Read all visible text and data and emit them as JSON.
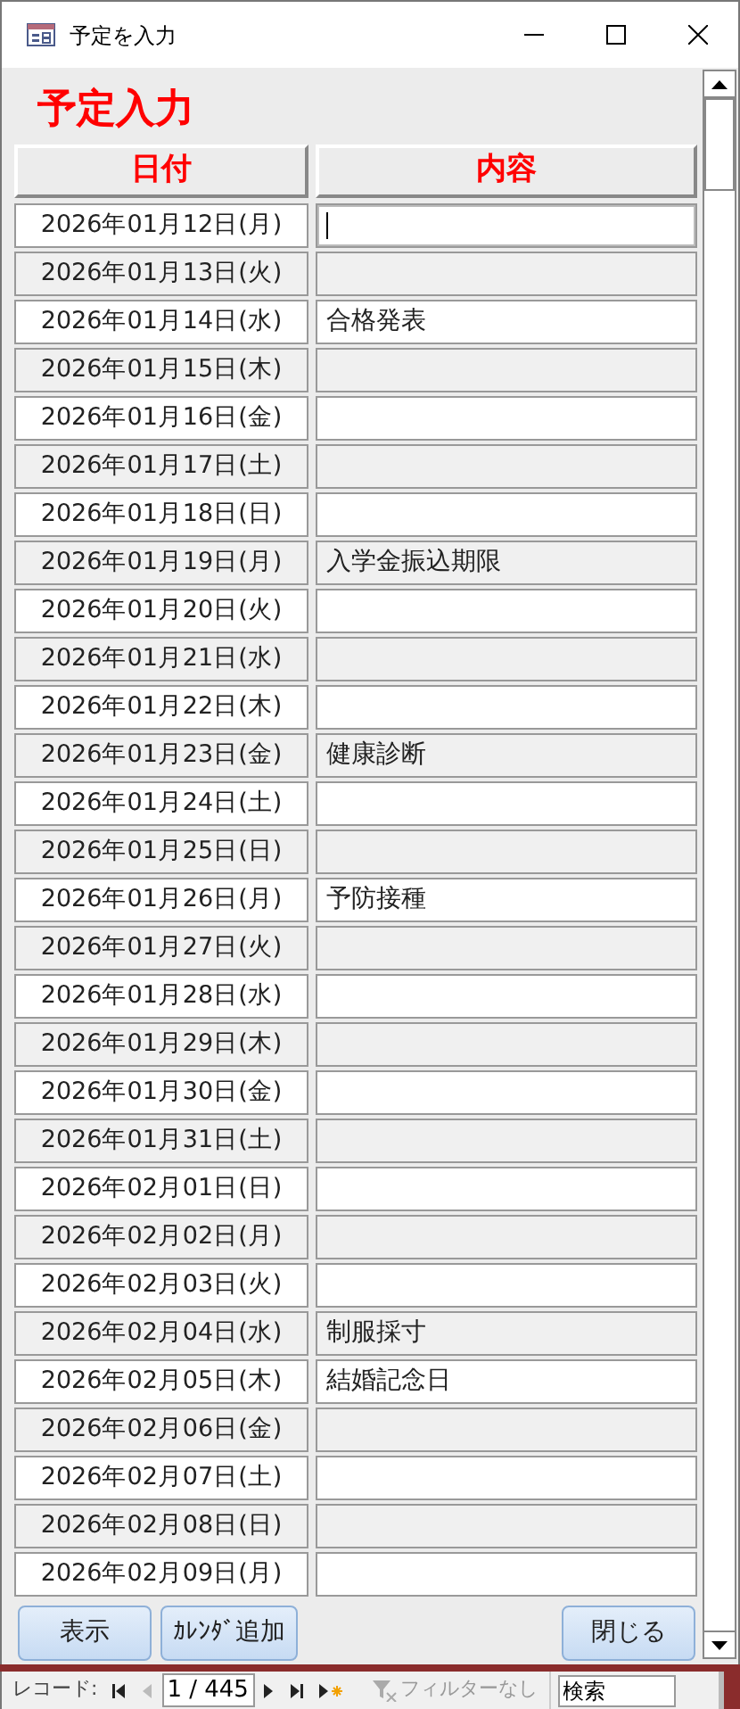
{
  "window": {
    "title": "予定を入力"
  },
  "form": {
    "heading": "予定入力",
    "columns": [
      "日付",
      "内容"
    ],
    "rows": [
      {
        "date": "2026年01月12日(月)",
        "content": "",
        "focused": true
      },
      {
        "date": "2026年01月13日(火)",
        "content": "",
        "focused": false
      },
      {
        "date": "2026年01月14日(水)",
        "content": "合格発表",
        "focused": false
      },
      {
        "date": "2026年01月15日(木)",
        "content": "",
        "focused": false
      },
      {
        "date": "2026年01月16日(金)",
        "content": "",
        "focused": false
      },
      {
        "date": "2026年01月17日(土)",
        "content": "",
        "focused": false
      },
      {
        "date": "2026年01月18日(日)",
        "content": "",
        "focused": false
      },
      {
        "date": "2026年01月19日(月)",
        "content": "入学金振込期限",
        "focused": false
      },
      {
        "date": "2026年01月20日(火)",
        "content": "",
        "focused": false
      },
      {
        "date": "2026年01月21日(水)",
        "content": "",
        "focused": false
      },
      {
        "date": "2026年01月22日(木)",
        "content": "",
        "focused": false
      },
      {
        "date": "2026年01月23日(金)",
        "content": "健康診断",
        "focused": false
      },
      {
        "date": "2026年01月24日(土)",
        "content": "",
        "focused": false
      },
      {
        "date": "2026年01月25日(日)",
        "content": "",
        "focused": false
      },
      {
        "date": "2026年01月26日(月)",
        "content": "予防接種",
        "focused": false
      },
      {
        "date": "2026年01月27日(火)",
        "content": "",
        "focused": false
      },
      {
        "date": "2026年01月28日(水)",
        "content": "",
        "focused": false
      },
      {
        "date": "2026年01月29日(木)",
        "content": "",
        "focused": false
      },
      {
        "date": "2026年01月30日(金)",
        "content": "",
        "focused": false
      },
      {
        "date": "2026年01月31日(土)",
        "content": "",
        "focused": false
      },
      {
        "date": "2026年02月01日(日)",
        "content": "",
        "focused": false
      },
      {
        "date": "2026年02月02日(月)",
        "content": "",
        "focused": false
      },
      {
        "date": "2026年02月03日(火)",
        "content": "",
        "focused": false
      },
      {
        "date": "2026年02月04日(水)",
        "content": "制服採寸",
        "focused": false
      },
      {
        "date": "2026年02月05日(木)",
        "content": "結婚記念日",
        "focused": false
      },
      {
        "date": "2026年02月06日(金)",
        "content": "",
        "focused": false
      },
      {
        "date": "2026年02月07日(土)",
        "content": "",
        "focused": false
      },
      {
        "date": "2026年02月08日(日)",
        "content": "",
        "focused": false
      },
      {
        "date": "2026年02月09日(月)",
        "content": "",
        "focused": false
      }
    ],
    "buttons_left": [
      "表示",
      "ｶﾚﾝﾀﾞ追加"
    ],
    "buttons_right": [
      "閉じる"
    ]
  },
  "navigation": {
    "label": "レコード:",
    "before": [
      {
        "kind": "first",
        "disabled": false
      },
      {
        "kind": "prev",
        "disabled": true
      }
    ],
    "record": "1 / 445",
    "after": [
      {
        "kind": "next",
        "disabled": false
      },
      {
        "kind": "last",
        "disabled": false
      },
      {
        "kind": "new",
        "disabled": false
      }
    ],
    "filter": {
      "label": "フィルターなし",
      "disabled": true
    },
    "search": {
      "placeholder": "検索"
    }
  }
}
